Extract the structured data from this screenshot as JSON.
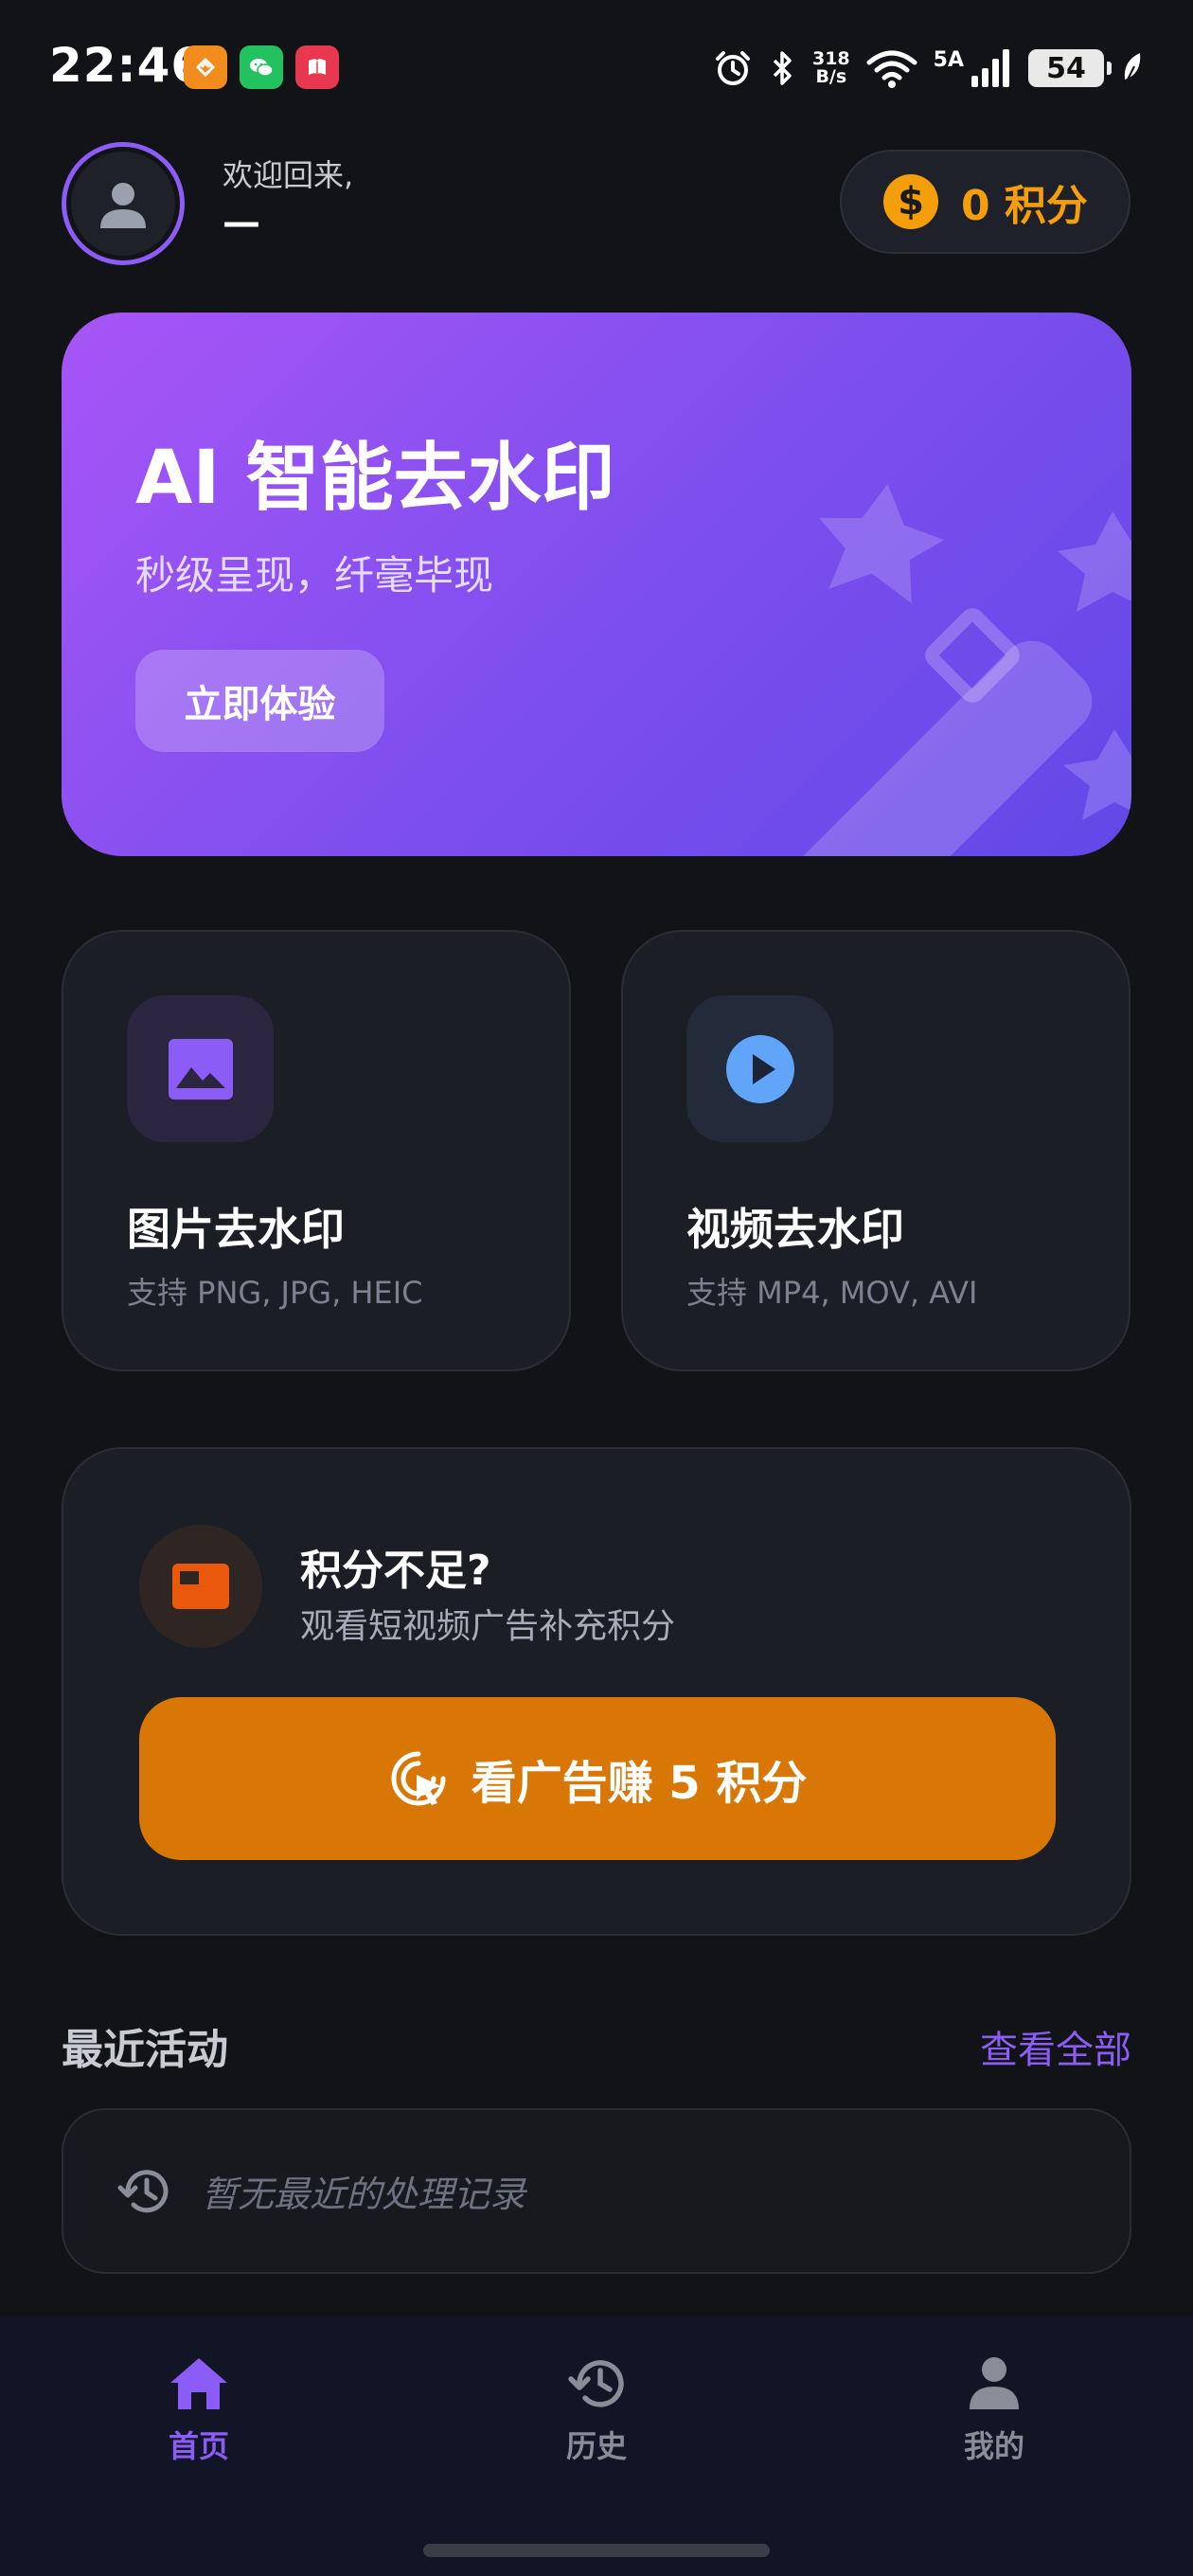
{
  "status_bar": {
    "time": "22:46",
    "net_speed_value": "318",
    "net_speed_unit": "B/s",
    "network": "5A",
    "battery": "54",
    "icons": [
      "alarm-icon",
      "bluetooth-icon",
      "wifi-icon",
      "signal-icon",
      "battery-icon",
      "leaf-icon"
    ],
    "notification_apps": [
      "orange-app-icon",
      "wechat-icon",
      "red-app-icon"
    ]
  },
  "header": {
    "welcome": "欢迎回来,",
    "username": "—",
    "points": "0 积分",
    "coin_symbol": "$"
  },
  "hero": {
    "title": "AI 智能去水印",
    "subtitle": "秒级呈现，纤毫毕现",
    "button": "立即体验"
  },
  "features": [
    {
      "title": "图片去水印",
      "subtitle": "支持 PNG, JPG, HEIC",
      "icon": "image-icon"
    },
    {
      "title": "视频去水印",
      "subtitle": "支持 MP4, MOV, AVI",
      "icon": "play-icon"
    }
  ],
  "ad": {
    "title": "积分不足?",
    "subtitle": "观看短视频广告补充积分",
    "button": "看广告赚 5 积分"
  },
  "recent": {
    "title": "最近活动",
    "view_all": "查看全部",
    "empty": "暂无最近的处理记录"
  },
  "nav": [
    {
      "label": "首页",
      "icon": "home-icon",
      "active": true
    },
    {
      "label": "历史",
      "icon": "history-icon",
      "active": false
    },
    {
      "label": "我的",
      "icon": "person-icon",
      "active": false
    }
  ],
  "colors": {
    "background": "#121317",
    "accent": "#8b5cf6",
    "coin": "#f59e0b",
    "ad_button": "#d97706",
    "card": "#1c1e25",
    "nav_bg": "#111525"
  }
}
